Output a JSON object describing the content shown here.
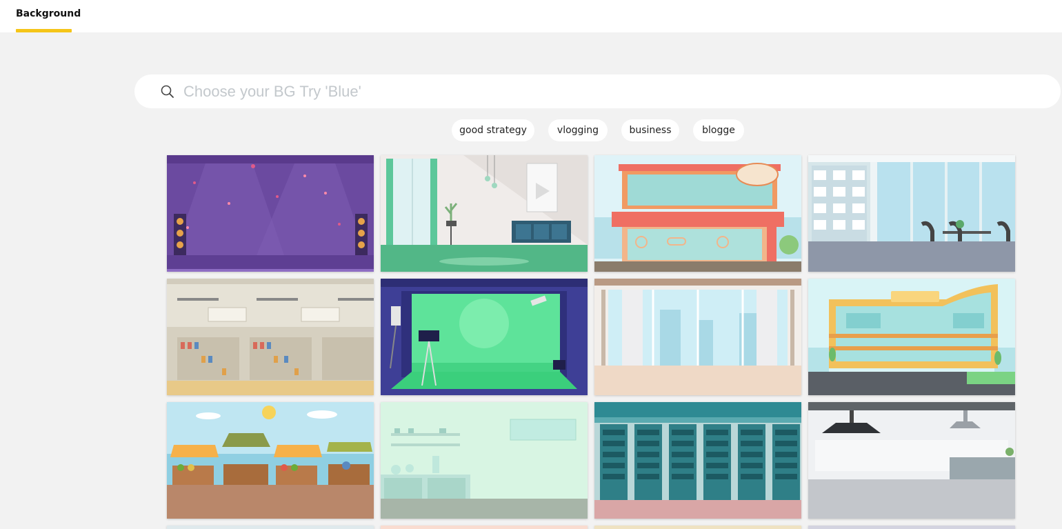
{
  "header": {
    "tab_label": "Background"
  },
  "search": {
    "placeholder": "Choose your BG Try 'Blue'",
    "value": ""
  },
  "tags": [
    "good strategy",
    "vlogging",
    "business",
    "blogge"
  ],
  "thumbnails": [
    "Purple concert stage",
    "Living room with window",
    "Shop storefront",
    "Office cafeteria",
    "Supermarket shelves",
    "Green screen studio",
    "Empty room with city view",
    "Modern building exterior",
    "Outdoor market stalls",
    "Laboratory",
    "Server room",
    "Kitchen"
  ],
  "colors": {
    "accent": "#f5c518",
    "page_bg": "#f2f2f2"
  }
}
